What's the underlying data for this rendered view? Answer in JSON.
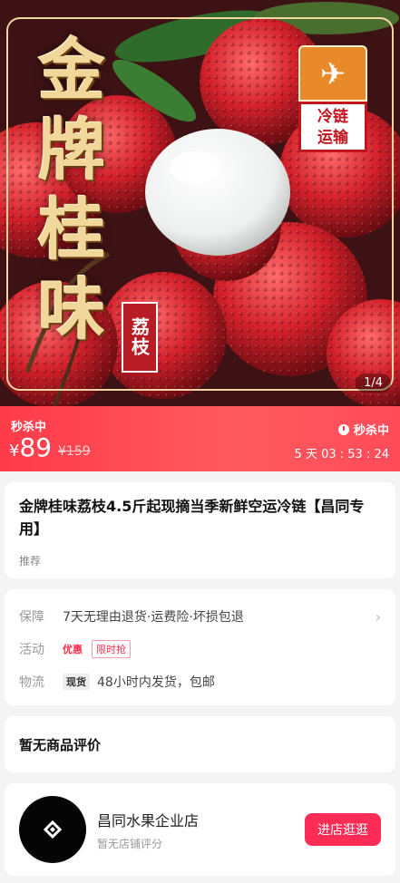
{
  "hero": {
    "title_chars": [
      "金",
      "牌",
      "桂",
      "味"
    ],
    "litchi_tag": "荔枝",
    "cold_badge_line1": "冷链",
    "cold_badge_line2": "运输",
    "pager": "1/4"
  },
  "price_bar": {
    "flash_label": "秒杀中",
    "currency": "¥",
    "price": "89",
    "original_price": "¥159",
    "right_title": "秒杀中",
    "countdown": "5 天 03 : 53 : 24"
  },
  "product": {
    "title": "金牌桂味荔枝4.5斤起现摘当季新鲜空运冷链【昌同专用】",
    "recommend": "推荐"
  },
  "service": {
    "guarantee_label": "保障",
    "guarantee_value": "7天无理由退货·运费险·坏损包退",
    "activity_label": "活动",
    "activity_tag1": "优惠",
    "activity_tag2": "限时抢",
    "logistics_label": "物流",
    "logistics_tag": "现货",
    "logistics_value": "48小时内发货，包邮"
  },
  "reviews": {
    "title": "暂无商品评价"
  },
  "shop": {
    "name": "昌同水果企业店",
    "score": "暂无店铺评分",
    "button": "进店逛逛"
  },
  "colors": {
    "accent": "#ff2c55",
    "price_bar": "#ff4b58"
  }
}
